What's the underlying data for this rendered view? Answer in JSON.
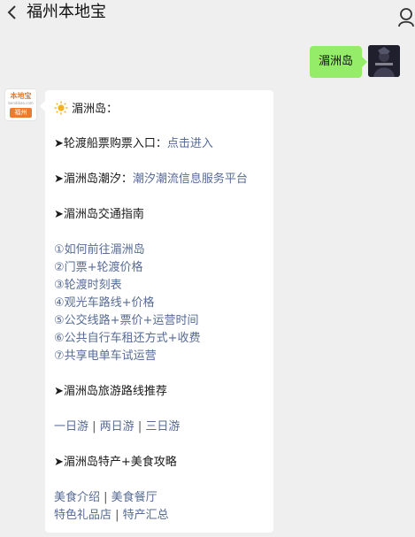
{
  "header": {
    "title": "福州本地宝",
    "back_icon": "chevron-left-icon",
    "profile_icon": "person-icon"
  },
  "outgoing": {
    "text": "湄洲岛"
  },
  "bot": {
    "avatar_top": "本地宝",
    "avatar_mid": "bendibao.com",
    "avatar_city": "福州"
  },
  "reply": {
    "heading": "湄洲岛：",
    "ticket_label": "➤轮渡船票购票入口：",
    "ticket_link": "点击进入",
    "tide_label": "➤湄洲岛潮汐：",
    "tide_link": "潮汐潮流信息服务平台",
    "transport_heading": "➤湄洲岛交通指南",
    "transport_links": [
      "①如何前往湄洲岛",
      "②门票+轮渡价格",
      "③轮渡时刻表",
      "④观光车路线+价格",
      "⑤公交线路+票价+运营时间",
      "⑥公共自行车租还方式+收费",
      "⑦共享电单车试运营"
    ],
    "route_heading": "➤湄洲岛旅游路线推荐",
    "route_links": [
      "一日游",
      "两日游",
      "三日游"
    ],
    "food_heading": "➤湄洲岛特产+美食攻略",
    "food_links_1": [
      "美食介绍",
      "美食餐厅"
    ],
    "food_links_2": [
      "特色礼品店",
      "特产汇总"
    ],
    "separator": " | "
  }
}
